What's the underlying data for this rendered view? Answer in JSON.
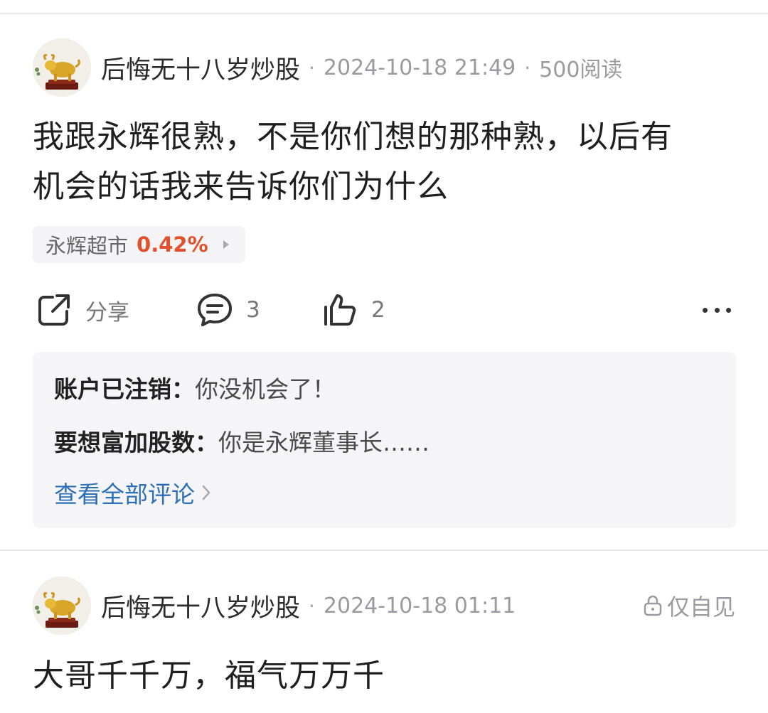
{
  "posts": [
    {
      "author": "后悔无十八岁炒股",
      "time": "2024-10-18 21:49",
      "reads": "500阅读",
      "text_line1": "我跟永辉很熟，不是你们想的那种熟，以后有",
      "text_line2": "机会的话我来告诉你们为什么",
      "stock": {
        "name": "永辉超市",
        "change": "0.42%",
        "change_color": "#e0512c"
      },
      "actions": {
        "share_label": "分享",
        "comment_count": "3",
        "like_count": "2"
      },
      "comments": [
        {
          "author": "账户已注销：",
          "text": "你没机会了！"
        },
        {
          "author": "要想富加股数：",
          "text": "你是永辉董事长……"
        }
      ],
      "view_all_label": "查看全部评论"
    },
    {
      "author": "后悔无十八岁炒股",
      "time": "2024-10-18 01:11",
      "visibility": "仅自见",
      "text_line1": "大哥千千万，福气万万千"
    }
  ],
  "icons": {
    "share": "share-icon",
    "comment": "comment-icon",
    "like": "thumbs-up-icon",
    "more": "more-dots-icon",
    "lock": "lock-icon",
    "arrow": "chevron-right-icon"
  },
  "colors": {
    "accent_link": "#2d6fb7",
    "stock_up": "#e0512c"
  }
}
